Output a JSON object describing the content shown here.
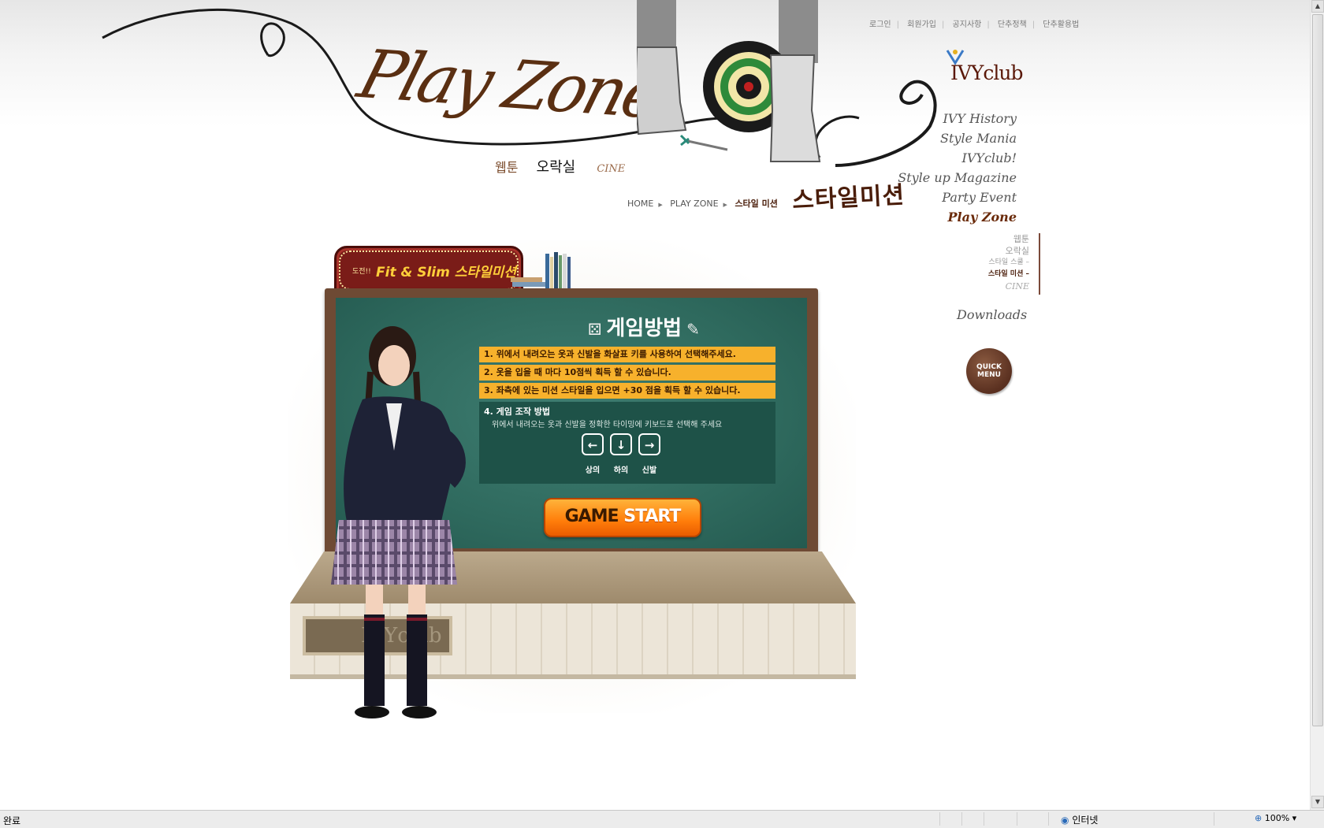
{
  "header": {
    "util_links": [
      "로그인",
      "회원가입",
      "공지사항",
      "단추정책",
      "단추활용법"
    ]
  },
  "logo": {
    "text": "IVYclub"
  },
  "playzone": {
    "title": "Play Zone",
    "sub": [
      "웹툰",
      "오락실",
      "CINE"
    ]
  },
  "breadcrumb": {
    "items": [
      "HOME",
      "PLAY ZONE",
      "스타일 미션"
    ],
    "page_title": "스타일미션"
  },
  "nav": {
    "items": [
      "IVY History",
      "Style Mania",
      "IVYclub!",
      "Style up Magazine",
      "Party Event",
      "Play Zone"
    ],
    "sub_items": [
      "웹툰",
      "오락실",
      "스타일 스쿨 –",
      "스타일 미션 –",
      "CINE"
    ],
    "downloads": "Downloads",
    "quick_menu": "QUICK MENU"
  },
  "game": {
    "sign_prefix": "도전!!",
    "sign_title": "Fit & Slim 스타일미션",
    "board_title": "게임방법",
    "rules": [
      "1. 위에서 내려오는 옷과 신발을 화살표 키를 사용하여 선택해주세요.",
      "2. 옷을 입을 때 마다 10점씩 획득 할 수 있습니다.",
      "3. 좌측에 있는 미션 스타일을 입으면 +30 점을 획득 할 수 있습니다."
    ],
    "controls_title": "4. 게임 조작 방법",
    "controls_desc": "위에서 내려오는 옷과 신발을 정확한 타이밍에 키보드로 선택해 주세요",
    "keys": [
      {
        "symbol": "←",
        "label": "상의"
      },
      {
        "symbol": "↓",
        "label": "하의"
      },
      {
        "symbol": "→",
        "label": "신발"
      }
    ],
    "start_a": "GAME",
    "start_b": "START",
    "plaque": "IVYclub"
  },
  "statusbar": {
    "left": "완료",
    "zone": "인터넷",
    "zoom": "100%"
  },
  "colors": {
    "brown": "#5a2f12",
    "board": "#2f6a5e",
    "rule": "#f7b12c",
    "start": "#ff7d0a"
  }
}
